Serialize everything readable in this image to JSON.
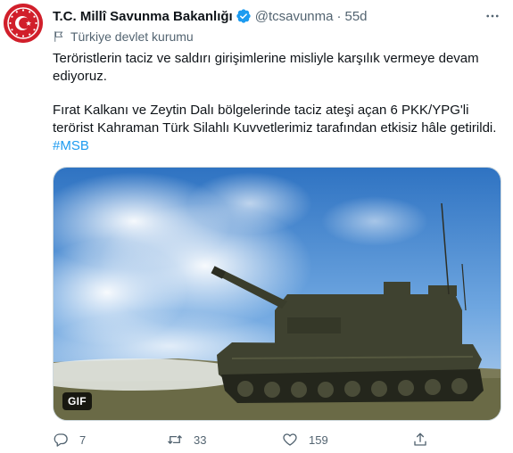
{
  "tweet": {
    "author_name": "T.C. Millî Savunma Bakanlığı",
    "handle": "@tcsavunma",
    "separator": "·",
    "time": "55d",
    "label": "Türkiye devlet kurumu",
    "paragraph1": "Teröristlerin taciz ve saldırı girişimlerine misliyle karşılık vermeye devam ediyoruz.",
    "paragraph2": "Fırat Kalkanı ve Zeytin Dalı bölgelerinde taciz ateşi açan 6 PKK/YPG'li terörist Kahraman Türk Silahlı Kuvvetlerimiz tarafından etkisiz hâle getirildi.",
    "hashtag": "#MSB",
    "media_badge": "GIF",
    "more_icon": "more-dots-icon",
    "verified_icon": "verified-badge-icon"
  },
  "actions": {
    "reply_count": "7",
    "retweet_count": "33",
    "like_count": "159",
    "icons": [
      "reply-icon",
      "retweet-icon",
      "like-icon",
      "share-icon"
    ]
  },
  "colors": {
    "text": "#0f1419",
    "secondary": "#536471",
    "accent": "#1d9bf0",
    "avatar_bg": "#d11f2b"
  }
}
